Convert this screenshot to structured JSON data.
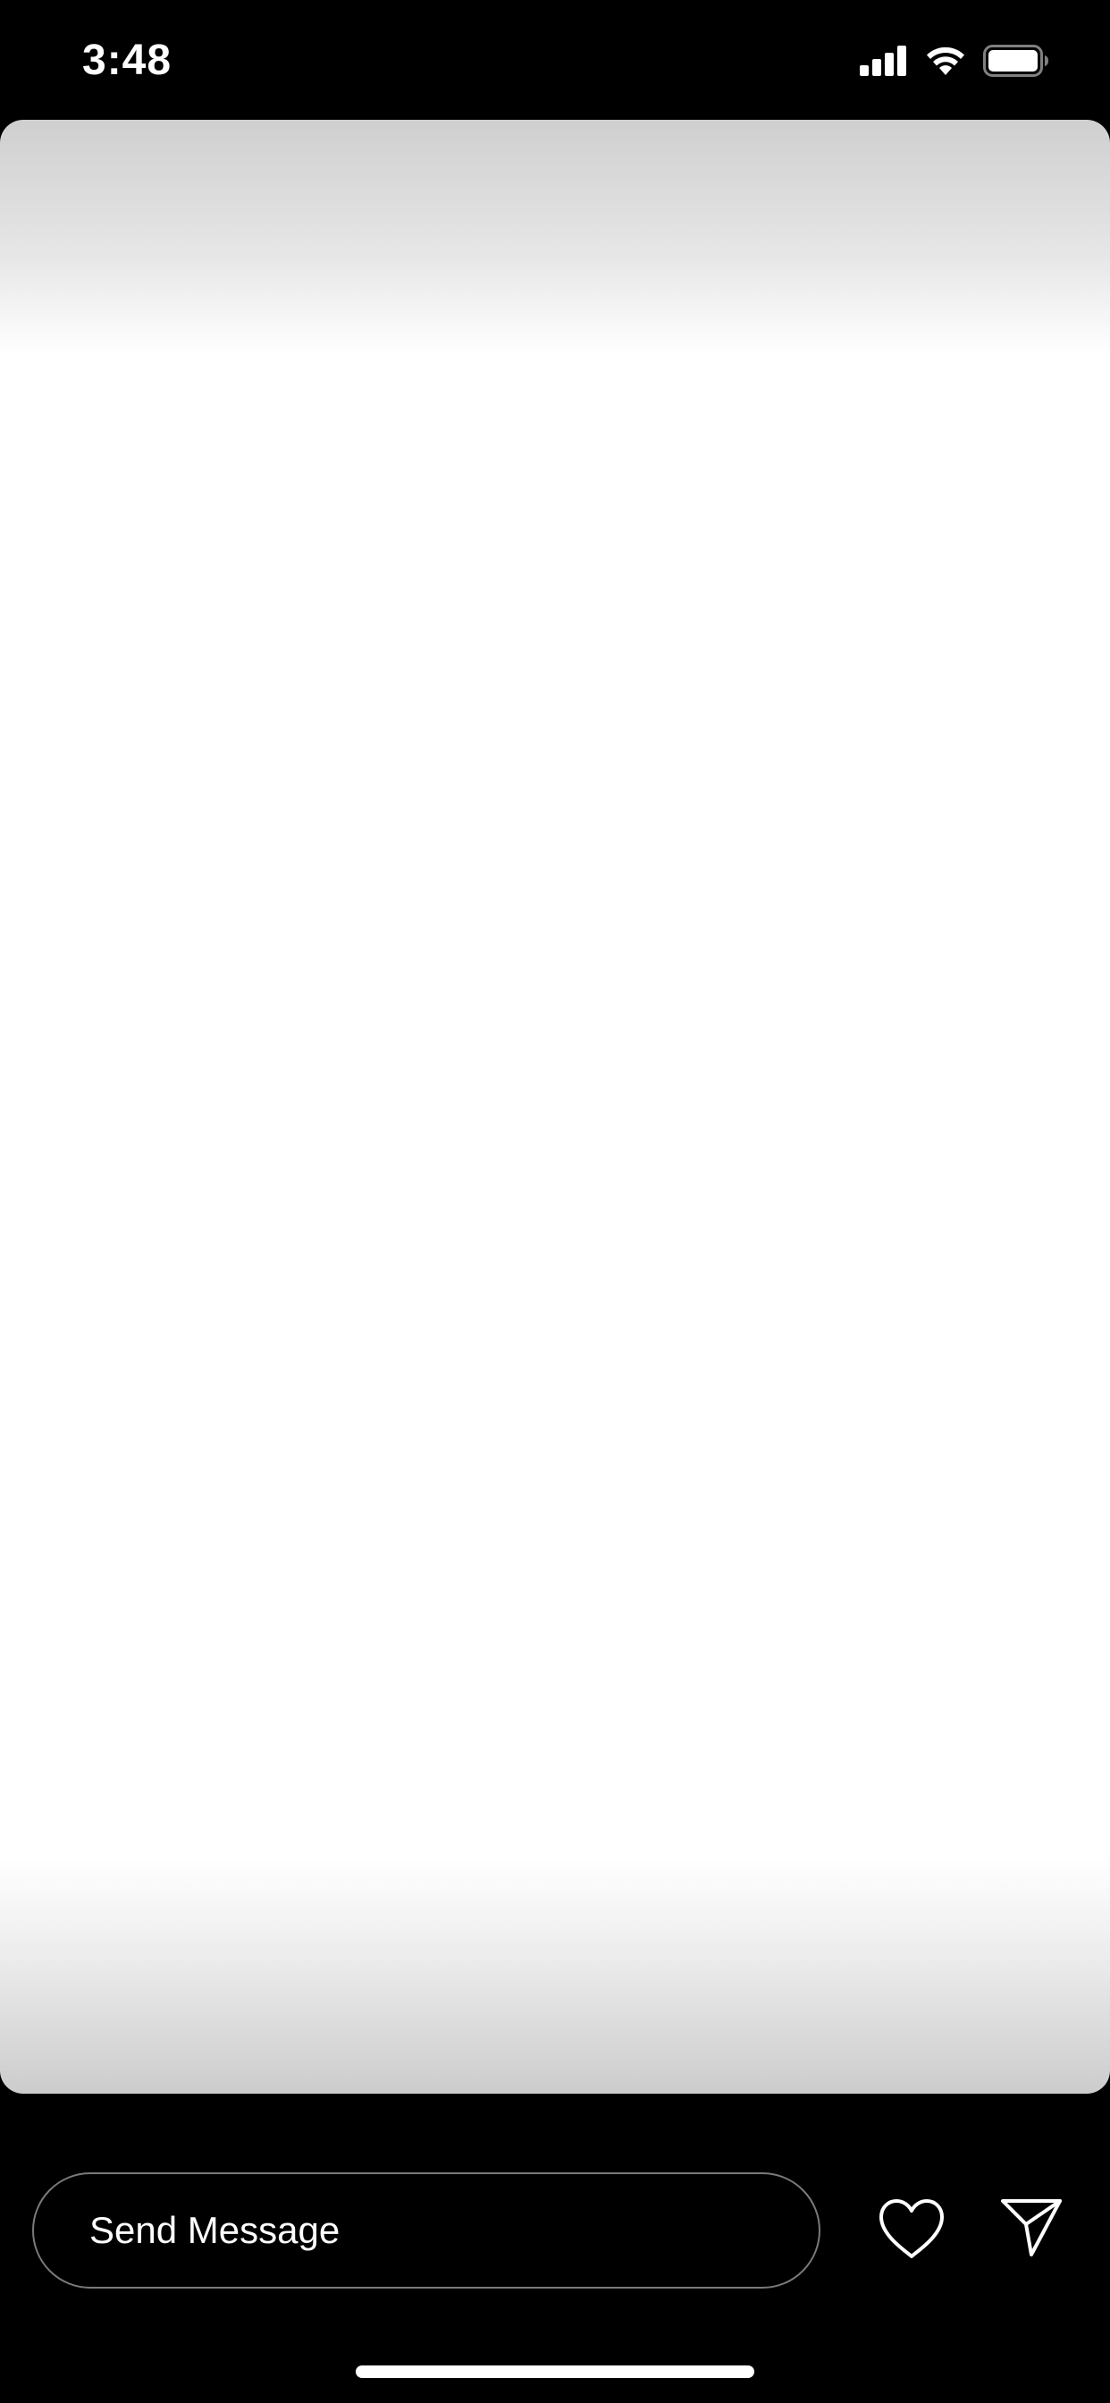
{
  "status_bar": {
    "time": "3:48",
    "icons": [
      "cellular-signal-icon",
      "wifi-icon",
      "battery-icon"
    ]
  },
  "story": {
    "content": ""
  },
  "reply": {
    "placeholder": "Send Message",
    "icons": [
      "heart-icon",
      "send-icon"
    ]
  },
  "colors": {
    "background": "#000000",
    "foreground": "#ffffff",
    "input_border": "#7a7a7a"
  }
}
